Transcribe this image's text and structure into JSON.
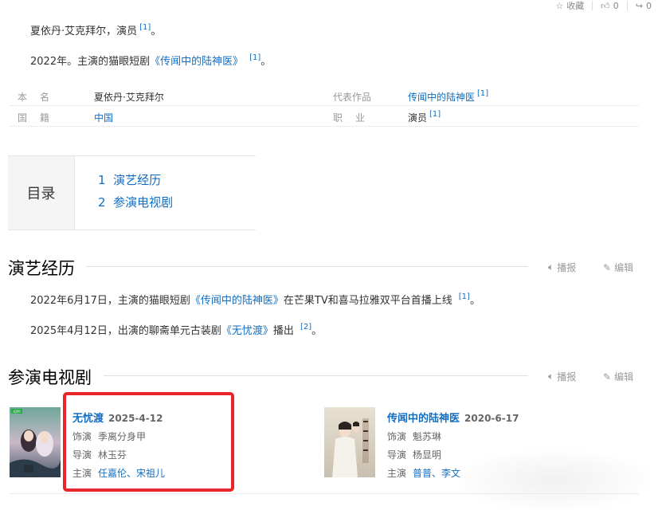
{
  "topbar": {
    "collect": "收藏",
    "likes": "0",
    "shares": "0"
  },
  "intro": {
    "line1": "夏依丹·艾克拜尔，演员",
    "line1_ref": "[1]",
    "line1_end": "。",
    "line2_pre": "2022年。主演的猫眼短剧",
    "line2_link": "《传闻中的陆神医》",
    "line2_ref": "[1]",
    "line2_end": "。"
  },
  "info": {
    "row1": {
      "label1": "本　名",
      "value1": "夏依丹·艾克拜尔",
      "label2": "代表作品",
      "value2": "传闻中的陆神医",
      "ref2": "[1]"
    },
    "row2": {
      "label1": "国　籍",
      "value1": "中国",
      "label2": "职　业",
      "value2": "演员",
      "ref2": "[1]"
    }
  },
  "toc": {
    "title": "目录",
    "items": [
      {
        "num": "1",
        "label": "演艺经历"
      },
      {
        "num": "2",
        "label": "参演电视剧"
      }
    ]
  },
  "section1": {
    "title": "演艺经历",
    "report": "播报",
    "edit": "编辑",
    "p1_pre": "2022年6月17日，主演的猫眼短剧",
    "p1_link": "《传闻中的陆神医》",
    "p1_post": "在芒果TV和喜马拉雅双平台首播上线",
    "p1_ref": "[1]",
    "p1_end": "。",
    "p2_pre": "2025年4月12日，出演的聊斋单元古装剧",
    "p2_link": "《无忧渡》",
    "p2_post": "播出",
    "p2_ref": "[2]",
    "p2_end": "。"
  },
  "section2": {
    "title": "参演电视剧",
    "report": "播报",
    "edit": "编辑"
  },
  "films": [
    {
      "title": "无忧渡",
      "date": "2025-4-12",
      "role_label": "饰演",
      "role": "季离分身甲",
      "director_label": "导演",
      "director": "林玉芬",
      "cast_label": "主演",
      "cast": "任嘉伦、宋祖儿",
      "poster_tag": "iQIYI"
    },
    {
      "title": "传闻中的陆神医",
      "date": "2020-6-17",
      "role_label": "饰演",
      "role": "魁苏琳",
      "director_label": "导演",
      "director": "杨显明",
      "cast_label": "主演",
      "cast": "普普、李文"
    }
  ],
  "colors": {
    "link": "#136ec2",
    "highlight_box": "#e8252b"
  }
}
